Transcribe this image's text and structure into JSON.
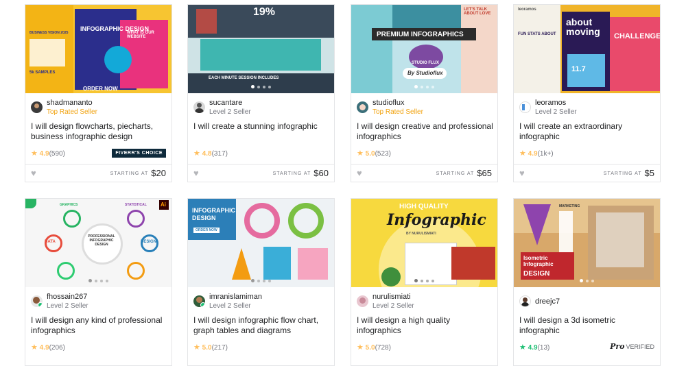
{
  "starting_label": "STARTING AT",
  "gigs": [
    {
      "seller": "shadmananto",
      "level": "Top Rated Seller",
      "title": "I will design flowcharts, piecharts, business infographic design",
      "score": "4.9",
      "reviews": "(590)",
      "price": "$20",
      "badge": "FIVERR'S CHOICE",
      "thumb": {
        "heading": "INFOGRAPHIC DESIGN",
        "sub": "ORDER NOW",
        "side": "WHAT IS OUR WEBSITE",
        "tag": "BUSINESS VISION 2025",
        "samples": "5k SAMPLES"
      }
    },
    {
      "seller": "sucantare",
      "level": "Level 2 Seller",
      "title": "I will create a stunning infographic",
      "score": "4.8",
      "reviews": "(317)",
      "price": "$60",
      "thumb": {
        "heading": "19%",
        "sub": "EACH MINUTE SESSION INCLUDES"
      }
    },
    {
      "seller": "studioflux",
      "level": "Top Rated Seller",
      "title": "I will design creative and professional infographics",
      "score": "5.0",
      "reviews": "(523)",
      "price": "$65",
      "thumb": {
        "heading": "PREMIUM INFOGRAPHICS",
        "sub": "By Studioflux",
        "logo": "STUDIO FLUX",
        "tag": "LET'S TALK ABOUT LOVE"
      }
    },
    {
      "seller": "leoramos",
      "level": "Level 2 Seller",
      "title": "I will create an extraordinary infographic",
      "score": "4.9",
      "reviews": "(1k+)",
      "price": "$5",
      "thumb": {
        "heading": "about moving",
        "sub": "CHALLENGE",
        "tag": "FUN STATS ABOUT",
        "num": "11.7",
        "logo": "leoramos"
      }
    },
    {
      "seller": "fhossain267",
      "level": "Level 2 Seller",
      "title": "I will design any kind of professional infographics",
      "score": "4.9",
      "reviews": "(206)",
      "thumb": {
        "heading": "PROFESSIONAL INFOGRAPHIC DESIGN",
        "l1": "GRAPHICS",
        "l2": "DATA",
        "l3": "STATISTICAL",
        "l4": "DESIGN",
        "ai": "Ai"
      }
    },
    {
      "seller": "imranislamiman",
      "level": "Level 2 Seller",
      "title": "I will design infographic flow chart, graph tables and diagrams",
      "score": "5.0",
      "reviews": "(217)",
      "thumb": {
        "heading": "INFOGRAPHIC DESIGN",
        "sub": "ORDER NOW"
      }
    },
    {
      "seller": "nurulismiati",
      "level": "Level 2 Seller",
      "title": "I will design a high quality infographics",
      "score": "5.0",
      "reviews": "(728)",
      "thumb": {
        "heading": "HIGH QUALITY",
        "script": "Infographic",
        "by": "BY NURULISMIATI"
      }
    },
    {
      "seller": "dreejc7",
      "level": "",
      "title": "I will design a 3d isometric infographic",
      "score": "4.9",
      "reviews": "(13)",
      "pro": "Pro",
      "pro_label": "VERIFIED",
      "thumb": {
        "heading": "Isometric Infographic",
        "sub": "DESIGN",
        "tag": "MARKETING"
      }
    }
  ],
  "colors": {
    "accent": "#1dbf73",
    "star": "#ffbe5b",
    "top_rated": "#f1a20d",
    "badge_bg": "#0e2a3b"
  }
}
